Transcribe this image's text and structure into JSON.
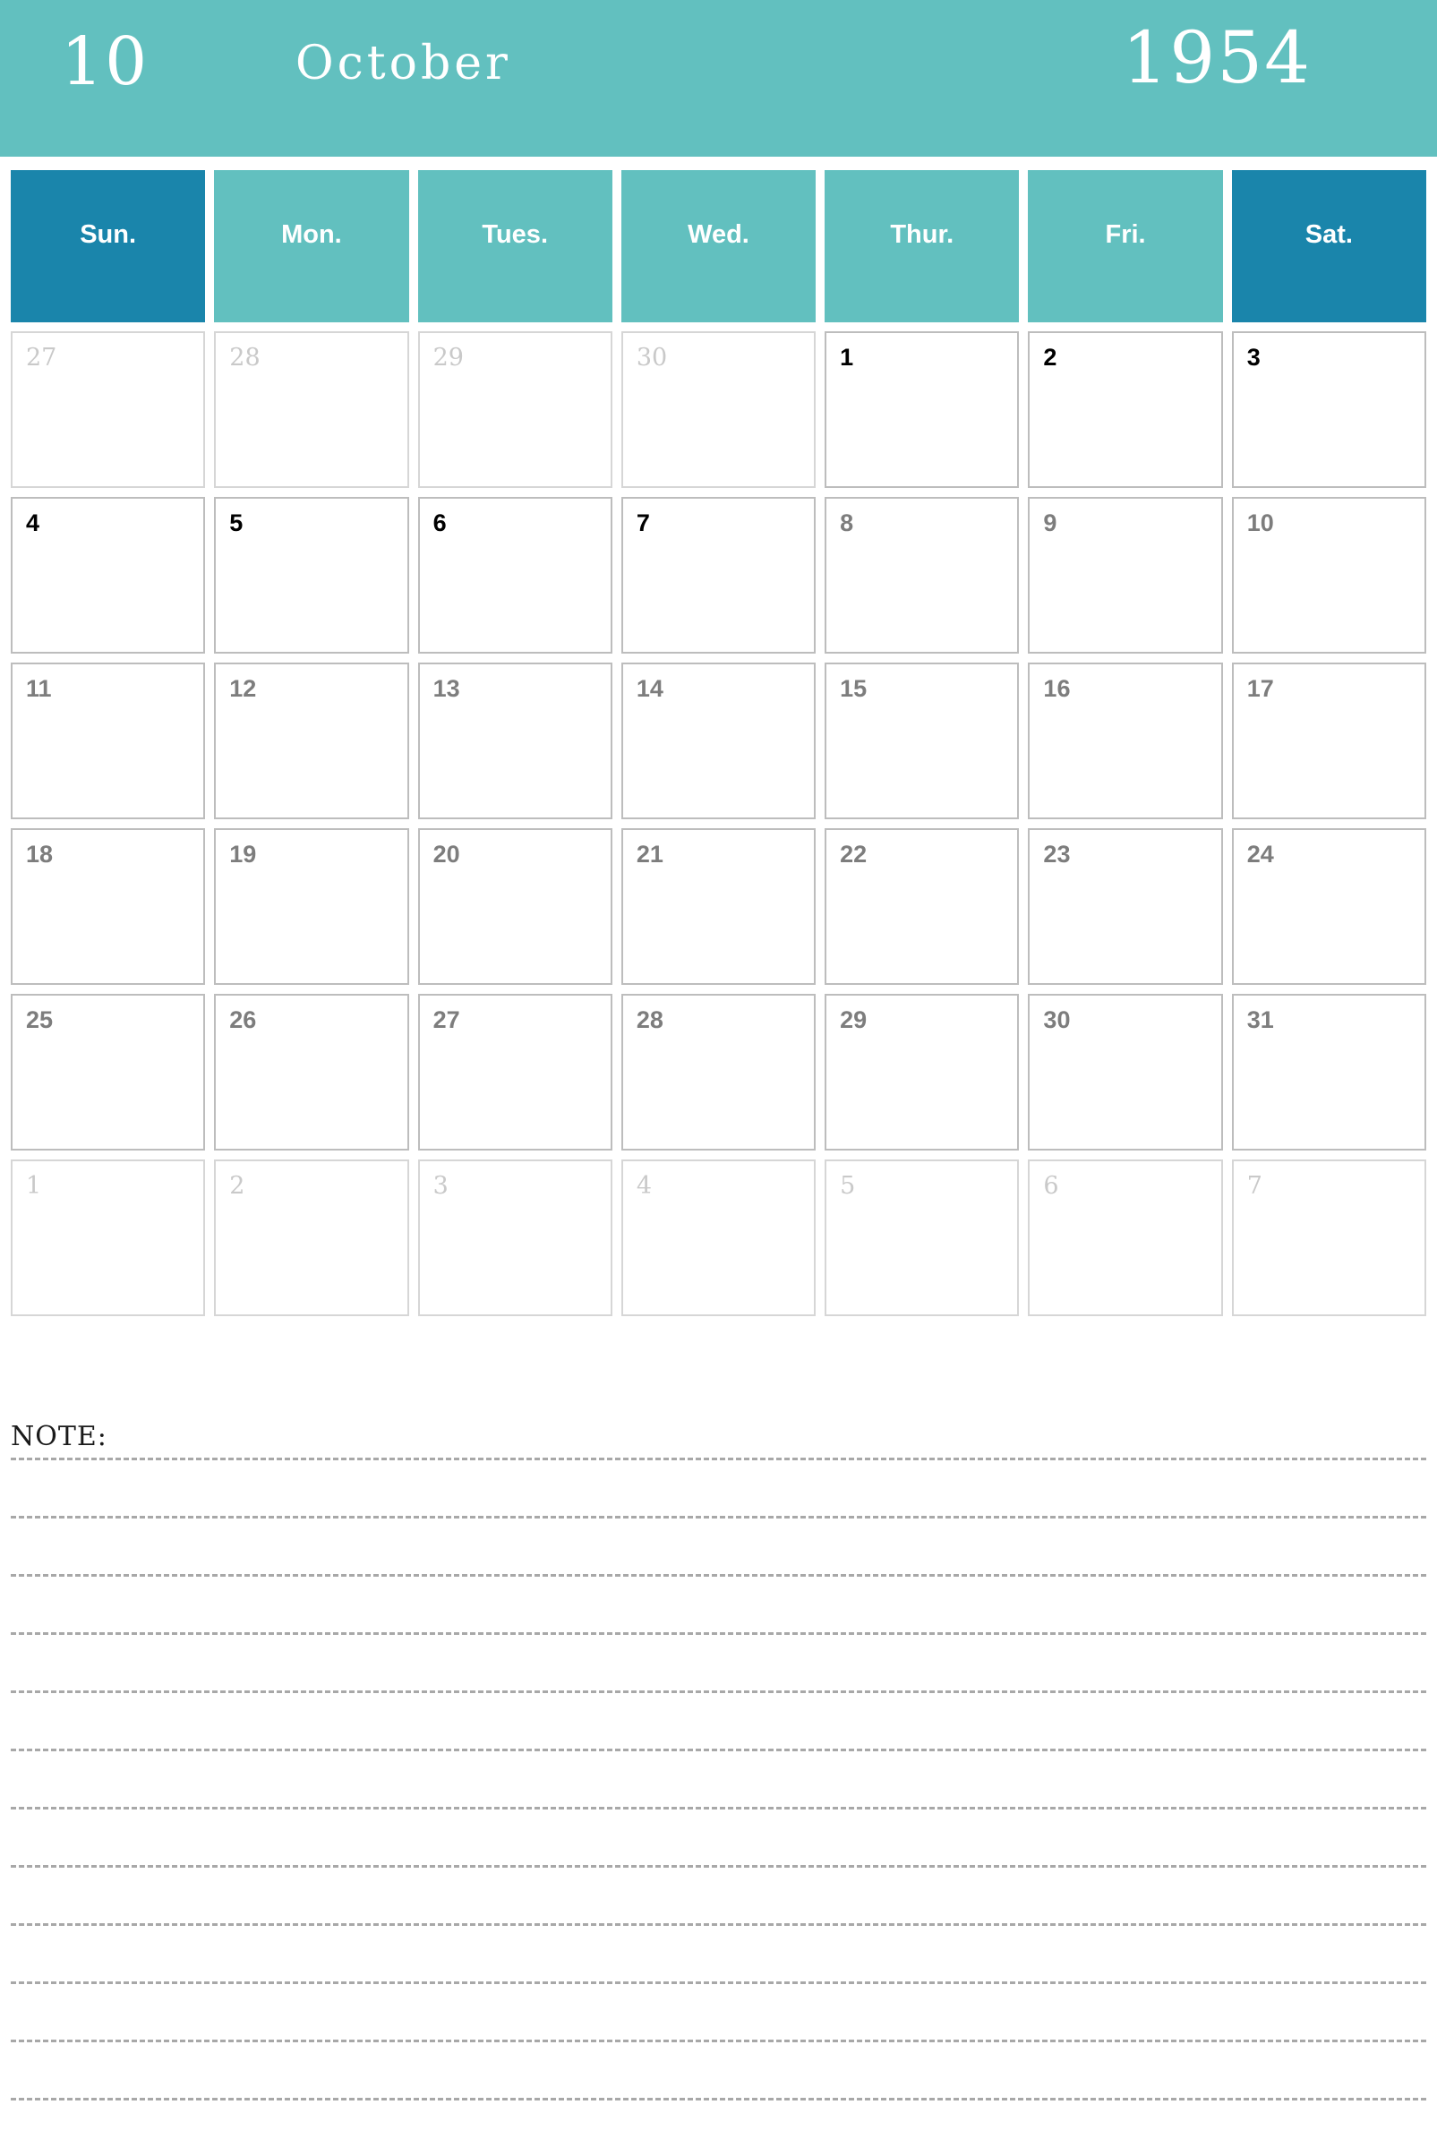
{
  "header": {
    "month_number": "10",
    "month_name": "October",
    "year": "1954",
    "band_color": "#62c0bf",
    "text_color": "#ffffff"
  },
  "weekdays": [
    {
      "label": "Sun.",
      "weekend": true
    },
    {
      "label": "Mon.",
      "weekend": false
    },
    {
      "label": "Tues.",
      "weekend": false
    },
    {
      "label": "Wed.",
      "weekend": false
    },
    {
      "label": "Thur.",
      "weekend": false
    },
    {
      "label": "Fri.",
      "weekend": false
    },
    {
      "label": "Sat.",
      "weekend": true
    }
  ],
  "colors": {
    "teal": "#62c0bf",
    "blue": "#1a85ab",
    "cell_border": "#bdbdbd",
    "current_day": "#000000",
    "month_day": "#7d7d7d",
    "adjacent_day": "#c9c9c9",
    "note_line": "#a8a8a8"
  },
  "weeks": [
    [
      {
        "num": "27",
        "type": "adjacent"
      },
      {
        "num": "28",
        "type": "adjacent"
      },
      {
        "num": "29",
        "type": "adjacent"
      },
      {
        "num": "30",
        "type": "adjacent"
      },
      {
        "num": "1",
        "type": "current"
      },
      {
        "num": "2",
        "type": "current"
      },
      {
        "num": "3",
        "type": "current"
      }
    ],
    [
      {
        "num": "4",
        "type": "current"
      },
      {
        "num": "5",
        "type": "current"
      },
      {
        "num": "6",
        "type": "current"
      },
      {
        "num": "7",
        "type": "current"
      },
      {
        "num": "8",
        "type": "month"
      },
      {
        "num": "9",
        "type": "month"
      },
      {
        "num": "10",
        "type": "month"
      }
    ],
    [
      {
        "num": "11",
        "type": "month"
      },
      {
        "num": "12",
        "type": "month"
      },
      {
        "num": "13",
        "type": "month"
      },
      {
        "num": "14",
        "type": "month"
      },
      {
        "num": "15",
        "type": "month"
      },
      {
        "num": "16",
        "type": "month"
      },
      {
        "num": "17",
        "type": "month"
      }
    ],
    [
      {
        "num": "18",
        "type": "month"
      },
      {
        "num": "19",
        "type": "month"
      },
      {
        "num": "20",
        "type": "month"
      },
      {
        "num": "21",
        "type": "month"
      },
      {
        "num": "22",
        "type": "month"
      },
      {
        "num": "23",
        "type": "month"
      },
      {
        "num": "24",
        "type": "month"
      }
    ],
    [
      {
        "num": "25",
        "type": "month"
      },
      {
        "num": "26",
        "type": "month"
      },
      {
        "num": "27",
        "type": "month"
      },
      {
        "num": "28",
        "type": "month"
      },
      {
        "num": "29",
        "type": "month"
      },
      {
        "num": "30",
        "type": "month"
      },
      {
        "num": "31",
        "type": "month"
      }
    ],
    [
      {
        "num": "1",
        "type": "adjacent"
      },
      {
        "num": "2",
        "type": "adjacent"
      },
      {
        "num": "3",
        "type": "adjacent"
      },
      {
        "num": "4",
        "type": "adjacent"
      },
      {
        "num": "5",
        "type": "adjacent"
      },
      {
        "num": "6",
        "type": "adjacent"
      },
      {
        "num": "7",
        "type": "adjacent"
      }
    ]
  ],
  "note": {
    "label": "NOTE:",
    "line_count": 12
  }
}
